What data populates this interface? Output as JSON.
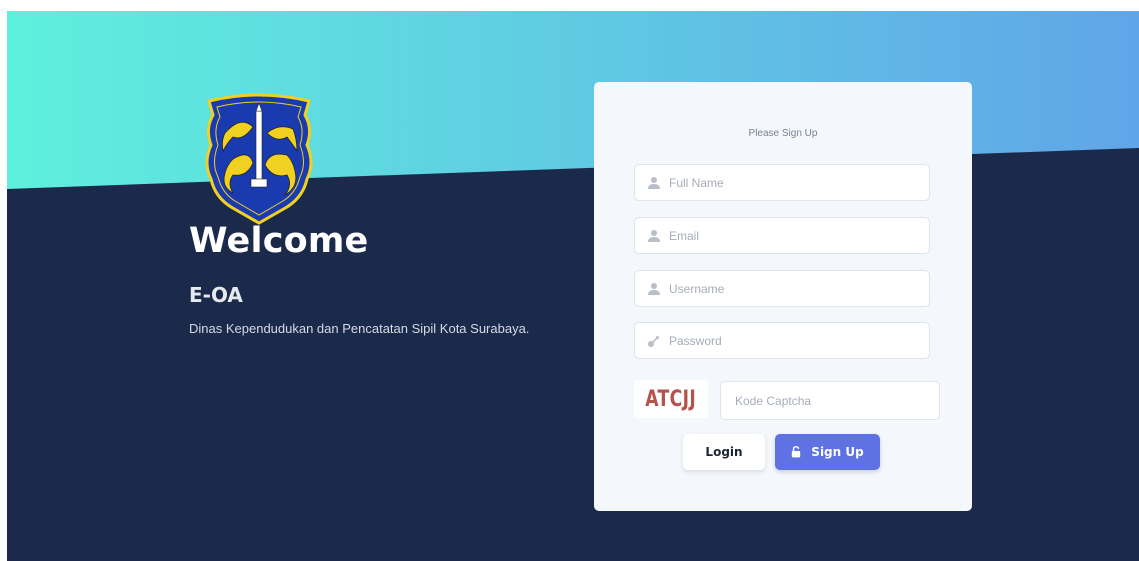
{
  "hero": {
    "welcome": "Welcome",
    "app_name": "E-OA",
    "description": "Dinas Kependudukan dan Pencatatan Sipil Kota Surabaya."
  },
  "form": {
    "title": "Please Sign Up",
    "fields": [
      {
        "placeholder": "Full Name",
        "icon": "user-icon"
      },
      {
        "placeholder": "Email",
        "icon": "user-icon"
      },
      {
        "placeholder": "Username",
        "icon": "user-icon"
      },
      {
        "placeholder": "Password",
        "icon": "key-icon"
      }
    ],
    "captcha": {
      "image_text": "ATCJJ",
      "placeholder": "Kode Captcha"
    },
    "buttons": {
      "login_label": "Login",
      "signup_label": "Sign Up",
      "signup_icon": "unlock-icon"
    }
  },
  "colors": {
    "gradient_start": "#5ef0dd",
    "gradient_end": "#60a5e8",
    "navy": "#1b2a4b",
    "card_bg": "#f4f7fb",
    "primary": "#5e72e4",
    "captcha_text": "#b5524a"
  }
}
